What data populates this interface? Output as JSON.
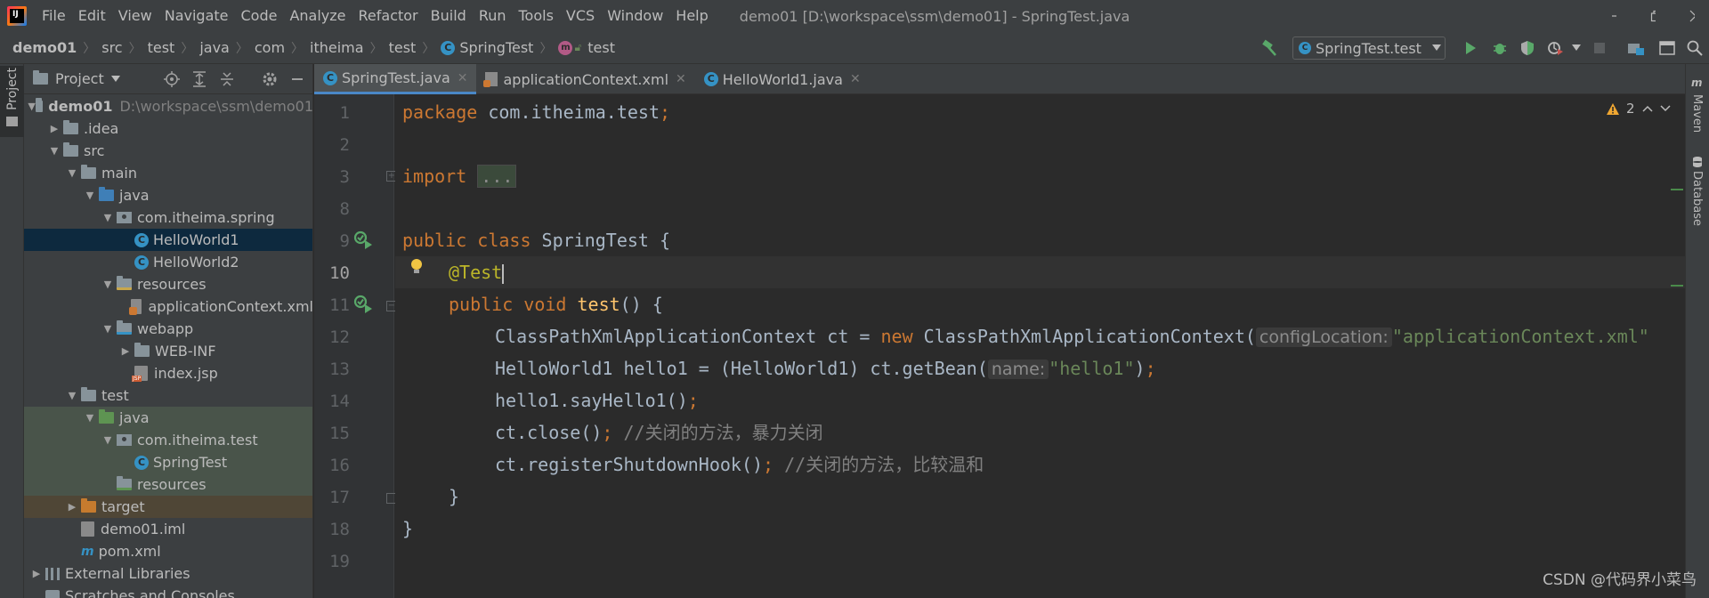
{
  "menu": {
    "items": [
      "File",
      "Edit",
      "View",
      "Navigate",
      "Code",
      "Analyze",
      "Refactor",
      "Build",
      "Run",
      "Tools",
      "VCS",
      "Window",
      "Help"
    ],
    "window_title": "demo01 [D:\\workspace\\ssm\\demo01] - SpringTest.java"
  },
  "breadcrumb": [
    "demo01",
    "src",
    "test",
    "java",
    "com",
    "itheima",
    "test",
    "SpringTest",
    "test"
  ],
  "run_config": {
    "label": "SpringTest.test"
  },
  "project_panel": {
    "title": "Project",
    "tree": [
      {
        "label": "demo01",
        "hint": "D:\\workspace\\ssm\\demo01"
      },
      {
        "label": ".idea"
      },
      {
        "label": "src"
      },
      {
        "label": "main"
      },
      {
        "label": "java"
      },
      {
        "label": "com.itheima.spring"
      },
      {
        "label": "HelloWorld1"
      },
      {
        "label": "HelloWorld2"
      },
      {
        "label": "resources"
      },
      {
        "label": "applicationContext.xml"
      },
      {
        "label": "webapp"
      },
      {
        "label": "WEB-INF"
      },
      {
        "label": "index.jsp"
      },
      {
        "label": "test"
      },
      {
        "label": "java"
      },
      {
        "label": "com.itheima.test"
      },
      {
        "label": "SpringTest"
      },
      {
        "label": "resources"
      },
      {
        "label": "target"
      },
      {
        "label": "demo01.iml"
      },
      {
        "label": "pom.xml"
      },
      {
        "label": "External Libraries"
      },
      {
        "label": "Scratches and Consoles"
      }
    ]
  },
  "tabs": [
    {
      "label": "SpringTest.java"
    },
    {
      "label": "applicationContext.xml"
    },
    {
      "label": "HelloWorld1.java"
    }
  ],
  "editor": {
    "warning_count": "2",
    "line_numbers": [
      "1",
      "2",
      "3",
      "8",
      "9",
      "10",
      "11",
      "12",
      "13",
      "14",
      "15",
      "16",
      "17",
      "18",
      "19"
    ],
    "code": {
      "l1_kw": "package",
      "l1_rest": " com.itheima.test",
      "semi": ";",
      "l3_kw": "import",
      "l3_fold": "...",
      "l9_kw": "public class",
      "l9_rest": " SpringTest {",
      "l10_ann": "@Test",
      "l11_kw": "public void",
      "l11_fn": "test",
      "l11_rest": "() {",
      "l12_a": "ClassPathXmlApplicationContext ct = ",
      "l12_new": "new",
      "l12_b": " ClassPathXmlApplicationContext(",
      "l12_hint": "configLocation:",
      "l12_str": "\"applicationContext.xml\"",
      "l13_a": "HelloWorld1 hello1 = (HelloWorld1) ct.getBean(",
      "l13_hint": "name:",
      "l13_str": "\"hello1\"",
      "l13_b": ")",
      "l14": "hello1.sayHello1()",
      "l15": "ct.close()",
      "l15_cmt": "//关闭的方法，暴力关闭",
      "l16": "ct.registerShutdownHook()",
      "l16_cmt": "//关闭的方法，比较温和",
      "l17": "}",
      "l18": "}"
    }
  },
  "right_stripe": [
    "Maven",
    "Database"
  ],
  "left_stripe": [
    "Project"
  ],
  "watermark": "CSDN @代码界小菜鸟"
}
